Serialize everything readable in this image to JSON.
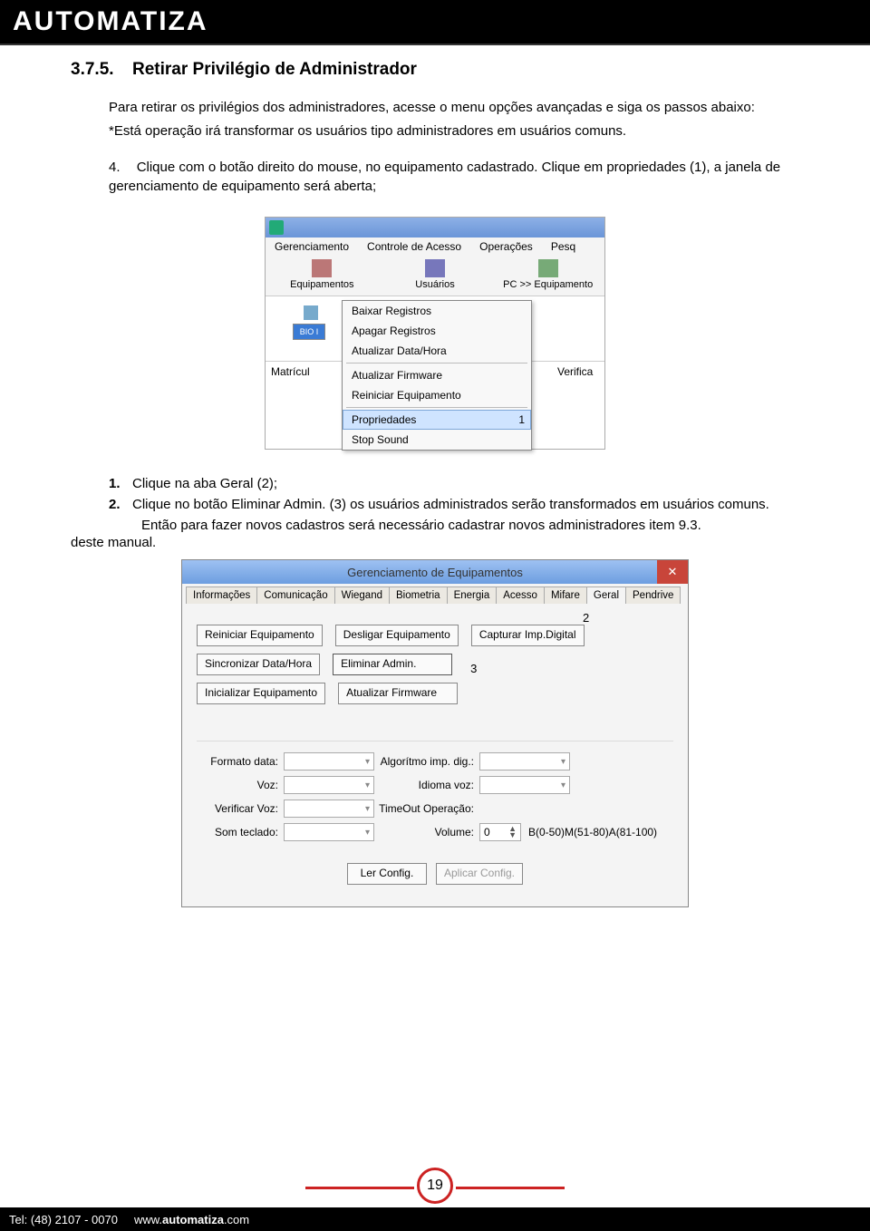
{
  "header": {
    "brand": "AUTOMATIZA"
  },
  "section": {
    "number": "3.7.5.",
    "title": "Retirar Privilégio de Administrador",
    "intro": "Para retirar os privilégios dos administradores, acesse o menu opções avançadas e siga os passos abaixo:",
    "note": "*Está operação irá transformar os usuários tipo administradores em usuários comuns.",
    "step4_num": "4.",
    "step4_text": "Clique com o botão direito do mouse, no equipamento cadastrado. Clique em propriedades (1), a janela de gerenciamento de equipamento será aberta;",
    "step1_num": "1.",
    "step1_text": "Clique na aba Geral (2);",
    "step2_num": "2.",
    "step2_text": "Clique no botão Eliminar Admin. (3) os usuários administrados serão transformados em usuários comuns.",
    "after": "Então para fazer novos cadastros será necessário cadastrar novos administradores item 9.3.",
    "deste": "deste manual."
  },
  "shot1": {
    "menus": [
      "Gerenciamento",
      "Controle de Acesso",
      "Operações",
      "Pesq"
    ],
    "toolbar": [
      "Equipamentos",
      "Usuários",
      "PC >> Equipamento"
    ],
    "bio": "BIO I",
    "matricula": "Matrícul",
    "verifica": "Verifica",
    "ctx": {
      "items_a": [
        "Baixar Registros",
        "Apagar Registros",
        "Atualizar Data/Hora"
      ],
      "items_b": [
        "Atualizar Firmware",
        "Reiniciar Equipamento"
      ],
      "prop": "Propriedades",
      "prop_badge": "1",
      "stop": "Stop Sound"
    }
  },
  "shot2": {
    "title": "Gerenciamento de Equipamentos",
    "tabs": [
      "Informações",
      "Comunicação",
      "Wiegand",
      "Biometria",
      "Energia",
      "Acesso",
      "Mifare",
      "Geral",
      "Pendrive"
    ],
    "num2": "2",
    "buttons": {
      "reiniciar": "Reiniciar Equipamento",
      "desligar": "Desligar Equipamento",
      "capturar": "Capturar Imp.Digital",
      "sinc": "Sincronizar Data/Hora",
      "eliminar": "Eliminar Admin.",
      "num3": "3",
      "inic": "Inicializar Equipamento",
      "atfw": "Atualizar Firmware"
    },
    "form": {
      "formato": "Formato data:",
      "algo": "Algorítmo imp. dig.:",
      "voz": "Voz:",
      "idioma": "Idioma voz:",
      "verificar": "Verificar Voz:",
      "timeout": "TimeOut Operação:",
      "som": "Som teclado:",
      "volume": "Volume:",
      "vol_val": "0",
      "vol_hint": "B(0-50)M(51-80)A(81-100)"
    },
    "bottom": {
      "ler": "Ler Config.",
      "aplicar": "Aplicar Config."
    }
  },
  "page_number": "19",
  "footer": {
    "tel": "Tel: (48) 2107 - 0070",
    "url_pre": "www.",
    "url_bold": "automatiza",
    "url_suf": ".com"
  }
}
